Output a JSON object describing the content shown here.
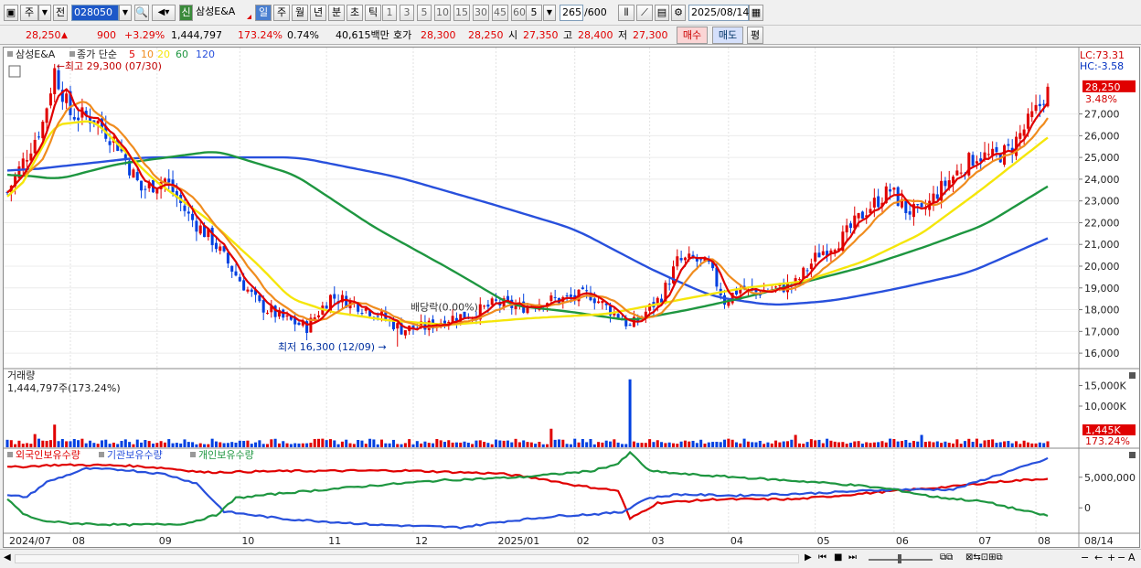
{
  "toolbar": {
    "mode_label": "주",
    "mode2_label": "전",
    "code_value": "028050",
    "stock_name": "삼성E&A",
    "badge_new": "신",
    "periods": [
      "일",
      "주",
      "월",
      "년",
      "분",
      "초",
      "틱"
    ],
    "selected_period": "일",
    "intervals": [
      "1",
      "3",
      "5",
      "10",
      "15",
      "30",
      "45",
      "60"
    ],
    "count_value": "5",
    "display_count": "265",
    "total_count": "/600",
    "date_value": "2025/08/14"
  },
  "quote": {
    "price": "28,250",
    "change": "900",
    "change_pct": "+3.29%",
    "volume": "1,444,797",
    "volume_ratio": "173.24%",
    "turnover": "0.74%",
    "amount": "40,615백만",
    "bid_label": "호가",
    "ask_price": "28,300",
    "bid_price": "28,250",
    "open_label": "시",
    "open": "27,350",
    "high_label": "고",
    "high": "28,400",
    "low_label": "저",
    "low": "27,300",
    "buy_label": "매수",
    "sell_label": "매도",
    "eval_label": "평"
  },
  "colors": {
    "up": "#e00000",
    "down": "#0040e0",
    "ma5": "#e00000",
    "ma10": "#f08c1e",
    "ma20": "#f5e60a",
    "ma60": "#1e9640",
    "ma120": "#2850dc",
    "foreign": "#e00000",
    "institution": "#2850dc",
    "individual": "#1e9640"
  },
  "chart_data": [
    {
      "type": "candlestick",
      "title": "삼성E&A",
      "legend": {
        "label": "종가 단순",
        "periods": [
          "5",
          "10",
          "20",
          "60",
          "120"
        ]
      },
      "ylim": [
        15500,
        29800
      ],
      "y_ticks": [
        "27,000",
        "26,000",
        "25,000",
        "24,000",
        "23,000",
        "22,000",
        "21,000",
        "20,000",
        "19,000",
        "18,000",
        "17,000",
        "16,000"
      ],
      "y_tick_values": [
        27000,
        26000,
        25000,
        24000,
        23000,
        22000,
        21000,
        20000,
        19000,
        18000,
        17000,
        16000
      ],
      "x_months": [
        "2024/07",
        "08",
        "09",
        "10",
        "11",
        "12",
        "2025/01",
        "02",
        "03",
        "04",
        "05",
        "06",
        "07",
        "08",
        "08/14"
      ],
      "annotations": {
        "high": "최고 29,300 (07/30)",
        "low": "최저 16,300 (12/09)",
        "dividend": "배당락(0.00%)",
        "lc": "LC:73.31",
        "hc": "HC:-3.58",
        "price_tag": "28,250",
        "pct_tag": "3.48%"
      },
      "close_waypoints": [
        [
          0,
          23400
        ],
        [
          4,
          24800
        ],
        [
          9,
          26600
        ],
        [
          12,
          29000
        ],
        [
          16,
          27000
        ],
        [
          22,
          26800
        ],
        [
          28,
          25600
        ],
        [
          34,
          23500
        ],
        [
          40,
          24000
        ],
        [
          46,
          22300
        ],
        [
          52,
          21200
        ],
        [
          58,
          19600
        ],
        [
          64,
          18200
        ],
        [
          70,
          17600
        ],
        [
          76,
          17200
        ],
        [
          82,
          18600
        ],
        [
          88,
          18300
        ],
        [
          94,
          17800
        ],
        [
          100,
          17100
        ],
        [
          106,
          17200
        ],
        [
          112,
          17600
        ],
        [
          118,
          17800
        ],
        [
          124,
          18300
        ],
        [
          130,
          18100
        ],
        [
          136,
          18400
        ],
        [
          142,
          18500
        ],
        [
          148,
          18700
        ],
        [
          152,
          18100
        ],
        [
          156,
          17600
        ],
        [
          158,
          17200
        ],
        [
          162,
          17900
        ],
        [
          166,
          18600
        ],
        [
          170,
          20200
        ],
        [
          174,
          20300
        ],
        [
          178,
          20000
        ],
        [
          182,
          18400
        ],
        [
          186,
          19000
        ],
        [
          190,
          18800
        ],
        [
          196,
          19000
        ],
        [
          200,
          19200
        ],
        [
          206,
          20600
        ],
        [
          212,
          21300
        ],
        [
          218,
          22600
        ],
        [
          224,
          23500
        ],
        [
          228,
          22600
        ],
        [
          232,
          22400
        ],
        [
          236,
          23400
        ],
        [
          242,
          24500
        ],
        [
          246,
          25100
        ],
        [
          250,
          25000
        ],
        [
          254,
          25300
        ],
        [
          258,
          26300
        ],
        [
          262,
          27400
        ],
        [
          264,
          28250
        ]
      ],
      "ma20_waypoints": [
        [
          0,
          23200
        ],
        [
          10,
          26500
        ],
        [
          20,
          26700
        ],
        [
          35,
          24000
        ],
        [
          50,
          22000
        ],
        [
          62,
          20000
        ],
        [
          70,
          18500
        ],
        [
          80,
          17900
        ],
        [
          95,
          17500
        ],
        [
          110,
          17300
        ],
        [
          130,
          17600
        ],
        [
          150,
          17800
        ],
        [
          170,
          18500
        ],
        [
          185,
          19000
        ],
        [
          200,
          19300
        ],
        [
          215,
          20200
        ],
        [
          230,
          21500
        ],
        [
          245,
          23500
        ],
        [
          264,
          26200
        ]
      ],
      "ma60_waypoints": [
        [
          0,
          24200
        ],
        [
          10,
          24000
        ],
        [
          25,
          24700
        ],
        [
          50,
          25300
        ],
        [
          70,
          24200
        ],
        [
          90,
          21800
        ],
        [
          110,
          19800
        ],
        [
          125,
          18200
        ],
        [
          140,
          17900
        ],
        [
          155,
          17500
        ],
        [
          170,
          18000
        ],
        [
          185,
          18600
        ],
        [
          200,
          19300
        ],
        [
          215,
          20000
        ],
        [
          230,
          20900
        ],
        [
          245,
          21900
        ],
        [
          264,
          24000
        ]
      ],
      "ma120_waypoints": [
        [
          0,
          24400
        ],
        [
          30,
          25000
        ],
        [
          70,
          25000
        ],
        [
          95,
          24100
        ],
        [
          120,
          22800
        ],
        [
          140,
          21700
        ],
        [
          160,
          19800
        ],
        [
          175,
          18600
        ],
        [
          190,
          18200
        ],
        [
          205,
          18400
        ],
        [
          220,
          18900
        ],
        [
          240,
          19700
        ],
        [
          264,
          21600
        ]
      ],
      "close_labels": []
    },
    {
      "type": "bar",
      "title": "거래량",
      "value_label": "1,444,797주(173.24%)",
      "y_ticks": [
        "15,000K",
        "10,000K"
      ],
      "y_tick_values": [
        15000000,
        10000000
      ],
      "ylim": [
        0,
        18000000
      ],
      "last_value_tag": "1,445K",
      "last_pct_tag": "173.24%",
      "spike_index": 158,
      "spike_value": 16500000
    },
    {
      "type": "line",
      "series": [
        {
          "name": "외국인보유수량"
        },
        {
          "name": "기관보유수량"
        },
        {
          "name": "개인보유수량"
        }
      ],
      "y_ticks": [
        "5,000,000",
        "0"
      ],
      "y_tick_values": [
        5000000,
        0
      ],
      "ylim": [
        -4000000,
        9000000
      ],
      "foreign_waypoints": [
        [
          0,
          6600
        ],
        [
          6,
          6800
        ],
        [
          12,
          7000
        ],
        [
          20,
          7000
        ],
        [
          30,
          6900
        ],
        [
          40,
          6500
        ],
        [
          50,
          5800
        ],
        [
          70,
          6000
        ],
        [
          100,
          6100
        ],
        [
          125,
          5600
        ],
        [
          135,
          4800
        ],
        [
          145,
          3600
        ],
        [
          155,
          2800
        ],
        [
          158,
          -1800
        ],
        [
          165,
          800
        ],
        [
          180,
          1400
        ],
        [
          200,
          1400
        ],
        [
          220,
          2500
        ],
        [
          240,
          3500
        ],
        [
          250,
          4200
        ],
        [
          264,
          4800
        ]
      ],
      "institution_waypoints": [
        [
          0,
          2000
        ],
        [
          5,
          1800
        ],
        [
          10,
          4200
        ],
        [
          20,
          6400
        ],
        [
          30,
          6200
        ],
        [
          40,
          5500
        ],
        [
          48,
          4000
        ],
        [
          55,
          -600
        ],
        [
          70,
          -1800
        ],
        [
          95,
          -2800
        ],
        [
          115,
          -3200
        ],
        [
          125,
          -2300
        ],
        [
          140,
          -1300
        ],
        [
          150,
          -1000
        ],
        [
          156,
          -700
        ],
        [
          162,
          1500
        ],
        [
          170,
          2200
        ],
        [
          185,
          2000
        ],
        [
          205,
          2400
        ],
        [
          225,
          3000
        ],
        [
          240,
          3000
        ],
        [
          252,
          5500
        ],
        [
          264,
          8000
        ]
      ],
      "individual_waypoints": [
        [
          0,
          1500
        ],
        [
          4,
          -1000
        ],
        [
          8,
          -2000
        ],
        [
          15,
          -2500
        ],
        [
          30,
          -2800
        ],
        [
          45,
          -2600
        ],
        [
          53,
          -1200
        ],
        [
          58,
          1600
        ],
        [
          70,
          2400
        ],
        [
          90,
          3500
        ],
        [
          110,
          4500
        ],
        [
          130,
          5000
        ],
        [
          148,
          6000
        ],
        [
          155,
          7200
        ],
        [
          158,
          9000
        ],
        [
          163,
          6000
        ],
        [
          172,
          5500
        ],
        [
          190,
          4800
        ],
        [
          205,
          4200
        ],
        [
          215,
          3700
        ],
        [
          225,
          3000
        ],
        [
          235,
          1800
        ],
        [
          248,
          1000
        ],
        [
          258,
          -500
        ],
        [
          264,
          -1300
        ]
      ]
    }
  ],
  "scrollbar": {
    "left_arrow": "◀",
    "right_arrow": "▶",
    "zoom_out": "−",
    "zoom_in": "+",
    "font_btn": "A"
  }
}
